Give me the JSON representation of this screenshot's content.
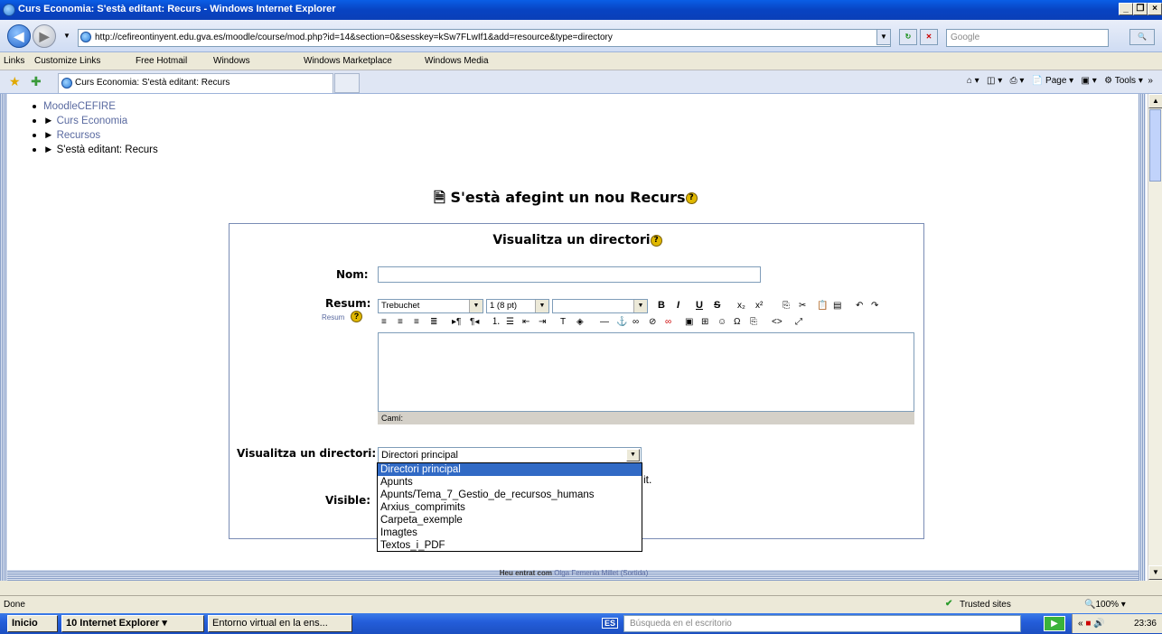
{
  "window": {
    "title": "Curs Economia: S'està editant: Recurs - Windows Internet Explorer"
  },
  "browser": {
    "url": "http://cefireontinyent.edu.gva.es/moodle/course/mod.php?id=14&section=0&sesskey=kSw7FLwIf1&add=resource&type=directory",
    "search_placeholder": "Google",
    "links": [
      "Links",
      "Customize Links",
      "Free Hotmail",
      "Windows",
      "Windows Marketplace",
      "Windows Media"
    ],
    "tab_title": "Curs Economia: S'està editant: Recurs",
    "commands": {
      "page": "Page",
      "tools": "Tools"
    }
  },
  "breadcrumb": [
    "MoodleCEFIRE",
    "Curs Economia",
    "Recursos",
    "S'està editant: Recurs"
  ],
  "heading": "S'està afegint un nou Recurs",
  "form": {
    "title": "Visualitza un directori",
    "nom_label": "Nom:",
    "nom_value": "",
    "resum_label": "Resum:",
    "resum_help": "Resum",
    "font_family": "Trebuchet",
    "font_size": "1 (8 pt)",
    "format_value": "",
    "path_label": "Camí:",
    "dir_label": "Visualitza un directori:",
    "dir_value": "Directori principal",
    "dir_options": [
      "Directori principal",
      "Apunts",
      "Apunts/Tema_7_Gestio_de_recursos_humans",
      "Arxius_comprimits",
      "Carpeta_exemple",
      "Imagtes",
      "Textos_i_PDF"
    ],
    "hidden_text_fragment": "it.",
    "visible_label": "Visible:"
  },
  "footer": {
    "prefix": "Heu entrat com",
    "user": "Olga Femenia Millet",
    "logout": "(Sortida)"
  },
  "status": {
    "left": "Done",
    "zone": "Trusted sites",
    "zoom": "100%"
  },
  "taskbar": {
    "start": "Inicio",
    "ie_group": "10 Internet Explorer",
    "doc_window": "Entorno virtual en la ens...",
    "lang": "ES",
    "desktop_search": "Búsqueda en el escritorio",
    "time": "23:36"
  }
}
